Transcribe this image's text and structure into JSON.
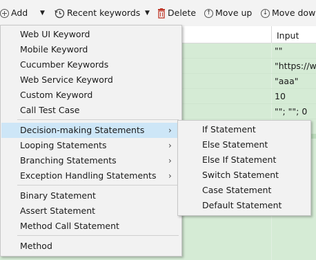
{
  "toolbar": {
    "add_label": "Add",
    "recent_label": "Recent keywords",
    "delete_label": "Delete",
    "move_up_label": "Move up",
    "move_down_label": "Move dow"
  },
  "table": {
    "column_title": "Input",
    "cells": [
      "\"\"",
      "\"https://ww",
      "\"aaa\"",
      "10",
      "\"\"; \"\"; 0"
    ]
  },
  "menu": {
    "items": [
      {
        "label": "Web UI Keyword"
      },
      {
        "label": "Mobile Keyword"
      },
      {
        "label": "Cucumber Keywords"
      },
      {
        "label": "Web Service Keyword"
      },
      {
        "label": "Custom Keyword"
      },
      {
        "label": "Call Test Case"
      },
      {
        "label": "Decision-making Statements",
        "submenu_glyph": "›"
      },
      {
        "label": "Looping Statements",
        "submenu_glyph": "›"
      },
      {
        "label": "Branching Statements",
        "submenu_glyph": "›"
      },
      {
        "label": "Exception Handling Statements",
        "submenu_glyph": "›"
      },
      {
        "label": "Binary Statement"
      },
      {
        "label": "Assert Statement"
      },
      {
        "label": "Method Call Statement"
      },
      {
        "label": "Method"
      }
    ]
  },
  "submenu": {
    "items": [
      {
        "label": "If Statement"
      },
      {
        "label": "Else Statement"
      },
      {
        "label": "Else If Statement"
      },
      {
        "label": "Switch Statement"
      },
      {
        "label": "Case Statement"
      },
      {
        "label": "Default Statement"
      }
    ]
  },
  "colors": {
    "table_background": "#d5ebd5",
    "menu_background": "#f2f2f2",
    "menu_highlight": "#cde6f7",
    "delete_icon": "#c0392b"
  }
}
